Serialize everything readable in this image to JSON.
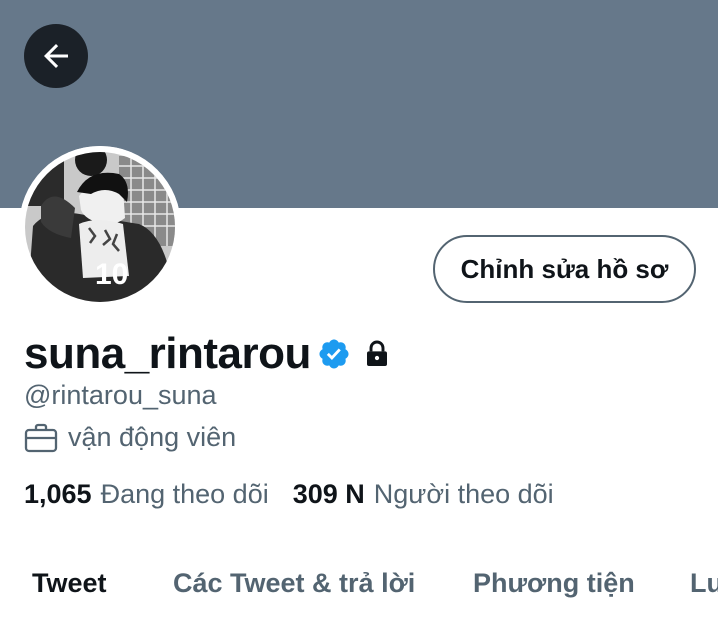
{
  "header": {
    "banner_color": "#66788a",
    "back_icon": "arrow-left-icon"
  },
  "profile": {
    "display_name": "suna_rintarou",
    "verified_icon": "verified-badge-icon",
    "protected_icon": "lock-icon",
    "handle": "@rintarou_suna",
    "bio_icon": "briefcase-icon",
    "bio": "vận động viên",
    "edit_button_label": "Chỉnh sửa hồ sơ"
  },
  "stats": {
    "following_count": "1,065",
    "following_label": "Đang theo dõi",
    "followers_count": "309 N",
    "followers_label": "Người theo dõi"
  },
  "tabs": [
    {
      "label": "Tweet",
      "active": true
    },
    {
      "label": "Các Tweet & trả lời",
      "active": false
    },
    {
      "label": "Phương tiện",
      "active": false
    },
    {
      "label": "Lu",
      "active": false
    }
  ],
  "colors": {
    "verified": "#1d9bf0",
    "text_primary": "#0f1419",
    "text_secondary": "#536471"
  }
}
